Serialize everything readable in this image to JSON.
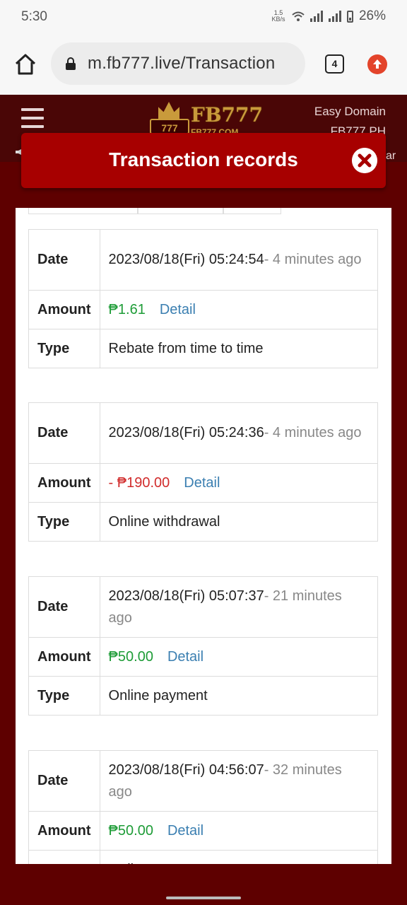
{
  "status_bar": {
    "time": "5:30",
    "speed_top": "1.5",
    "speed_bottom": "KB/s",
    "battery": "26%"
  },
  "browser": {
    "url": "m.fb777.live/Transaction",
    "tab_count": "4"
  },
  "site": {
    "logo_text": "FB777",
    "logo_sub": "FB777.COM",
    "logo_slot": "777",
    "easy_domain_line1": "Easy Domain",
    "easy_domain_line2": "FB777.PH",
    "marquee_tail": "ar"
  },
  "modal": {
    "title": "Transaction records"
  },
  "labels": {
    "date": "Date",
    "amount": "Amount",
    "type": "Type",
    "detail": "Detail"
  },
  "records": [
    {
      "date": "2023/08/18(Fri) 05:24:54",
      "relative": "- 4 minutes ago",
      "amount": "₱1.61",
      "amount_color": "#1e9c37",
      "type": "Rebate from time to time"
    },
    {
      "date": "2023/08/18(Fri) 05:24:36",
      "relative": "- 4 minutes ago",
      "amount": "- ₱190.00",
      "amount_color": "#d12c2c",
      "type": "Online withdrawal"
    },
    {
      "date": "2023/08/18(Fri) 05:07:37",
      "relative": "- 21 minutes ago",
      "amount": "₱50.00",
      "amount_color": "#1e9c37",
      "type": "Online payment"
    },
    {
      "date": "2023/08/18(Fri) 04:56:07",
      "relative": "- 32 minutes ago",
      "amount": "₱50.00",
      "amount_color": "#1e9c37",
      "type": "Onli"
    }
  ],
  "colors": {
    "header_bg": "#4a0606",
    "modal_title_bg": "#a70000",
    "page_bg": "#5e0000",
    "detail_link": "#3b7fb1"
  }
}
